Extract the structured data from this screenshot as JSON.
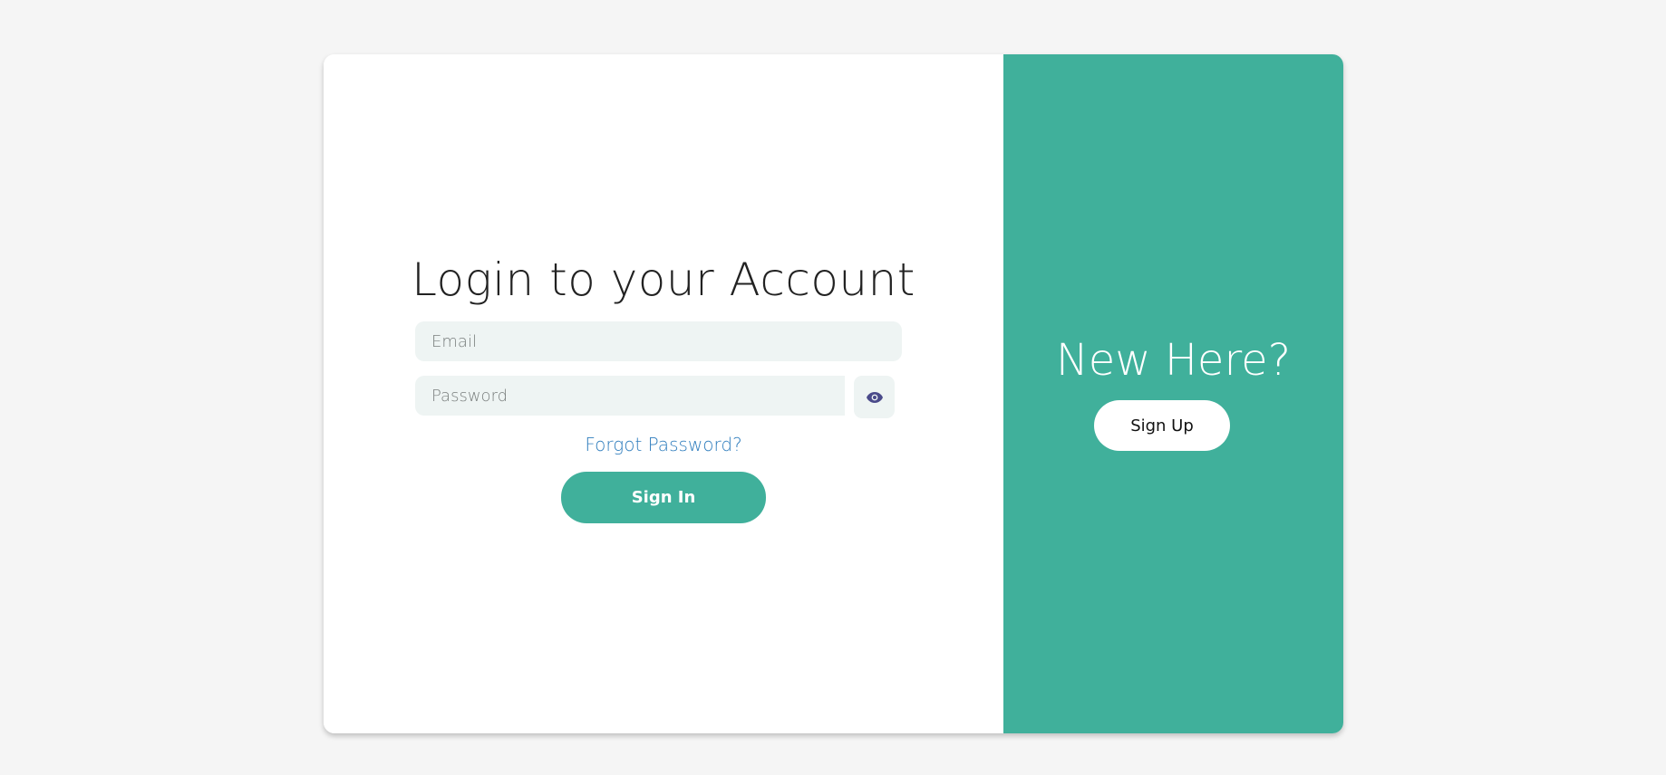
{
  "login": {
    "title": "Login to your Account",
    "email_placeholder": "Email",
    "password_placeholder": "Password",
    "forgot_password": "Forgot Password?",
    "sign_in_label": "Sign In",
    "toggle_icon": "eye-icon"
  },
  "signup_panel": {
    "heading": "New Here?",
    "sign_up_label": "Sign Up"
  },
  "colors": {
    "accent": "#40b09b",
    "link": "#2f7dbd",
    "input_bg": "#eef4f3",
    "page_bg": "#f5f5f5",
    "eye_icon": "#4a4a8a"
  }
}
